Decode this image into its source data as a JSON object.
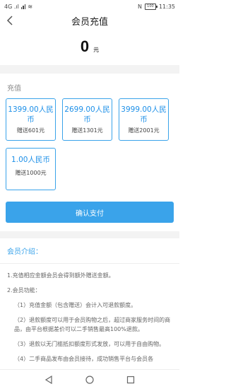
{
  "status_bar": {
    "left_text": "4G .ıl",
    "battery": "100",
    "time": "11:35"
  },
  "header": {
    "title": "会员充值"
  },
  "amount": {
    "value": "0",
    "unit": "元"
  },
  "recharge": {
    "section_label": "充值",
    "packages": [
      {
        "price": "1399.00人民币",
        "bonus": "赠送601元"
      },
      {
        "price": "2699.00人民币",
        "bonus": "赠送1301元"
      },
      {
        "price": "3999.00人民币",
        "bonus": "赠送2001元"
      },
      {
        "price": "1.00人民币",
        "bonus": "赠送1000元"
      }
    ],
    "confirm_label": "确认支付"
  },
  "intro": {
    "title": "会员介绍：",
    "paragraphs": [
      "1.充值相应金额会员会得到额外赠送金额。",
      "2.会员功能：",
      "（1）充值金额（包含赠送）会计入可退款额度。",
      "（2）退款额度可以用于会员购物之后，超过商家服务时间的商品，由平台根据差价可以二手销售最高100%退款。",
      "（3）退款以无门槛抵扣额度形式发放，可以用于自由购物。",
      "（4）二手商品发布由会员接待，成功销售平台与会员各"
    ]
  },
  "accent_color": "#3aa3ea"
}
